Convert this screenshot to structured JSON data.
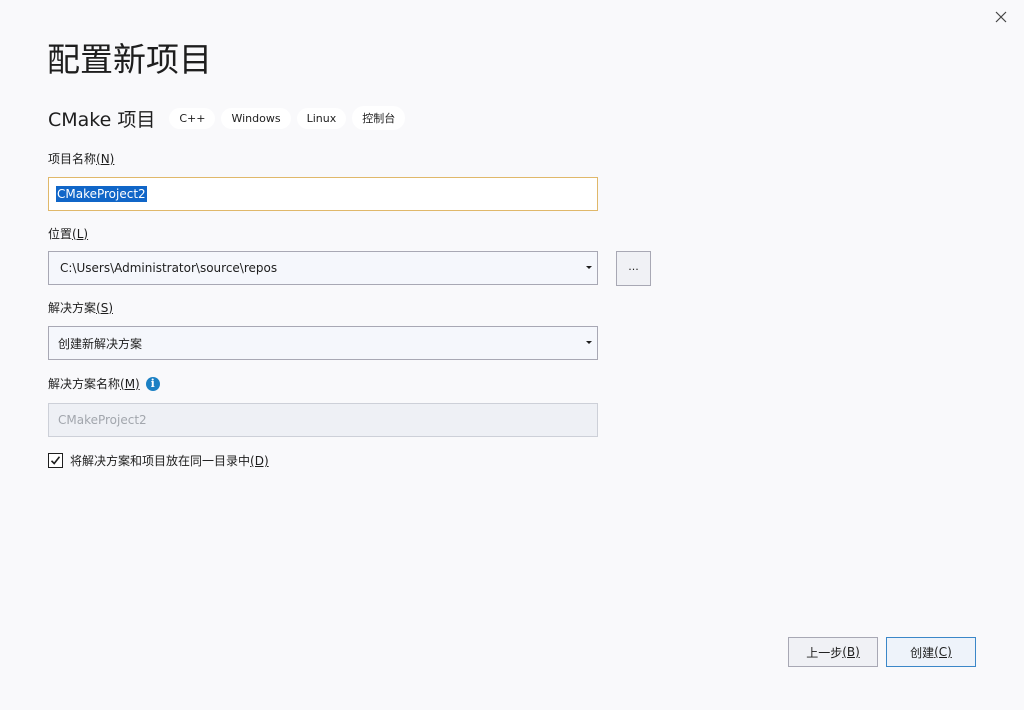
{
  "dialog": {
    "title": "配置新项目",
    "project_type": "CMake 项目",
    "tags": [
      "C++",
      "Windows",
      "Linux",
      "控制台"
    ]
  },
  "project_name": {
    "label": "项目名称",
    "accel": "(N)",
    "value": "CMakeProject2"
  },
  "location": {
    "label": "位置",
    "accel": "(L)",
    "value": "C:\\Users\\Administrator\\source\\repos",
    "browse_label": "..."
  },
  "solution": {
    "label": "解决方案",
    "accel": "(S)",
    "value": "创建新解决方案"
  },
  "solution_name": {
    "label": "解决方案名称",
    "accel": "(M)",
    "value": "CMakeProject2"
  },
  "same_dir": {
    "label": "将解决方案和项目放在同一目录中",
    "accel": "(D)",
    "checked": true
  },
  "buttons": {
    "back": "上一步",
    "back_accel": "(B)",
    "create": "创建",
    "create_accel": "(C)"
  },
  "icons": {
    "close": "close-icon",
    "info": "info-icon",
    "checkmark": "checkmark-icon",
    "dropdown": "chevron-down-icon"
  },
  "colors": {
    "background": "#f9f9fb",
    "selection": "#1066c8",
    "focus_border": "#e0b86a",
    "primary_border": "#3b87c8",
    "info": "#1b80c4"
  }
}
